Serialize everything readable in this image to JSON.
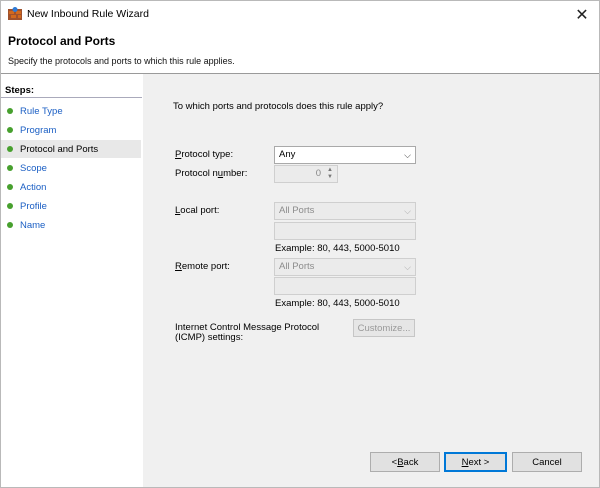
{
  "window": {
    "title": "New Inbound Rule Wizard",
    "close_glyph": "✕"
  },
  "header": {
    "title": "Protocol and Ports",
    "subtitle": "Specify the protocols and ports to which this rule applies."
  },
  "steps": {
    "heading": "Steps:",
    "items": [
      {
        "label": "Rule Type"
      },
      {
        "label": "Program"
      },
      {
        "label": "Protocol and Ports"
      },
      {
        "label": "Scope"
      },
      {
        "label": "Action"
      },
      {
        "label": "Profile"
      },
      {
        "label": "Name"
      }
    ],
    "active_index": 2
  },
  "main": {
    "question": "To which ports and protocols does this rule apply?",
    "protocol_type": {
      "label_prefix": "",
      "label_ul": "P",
      "label_rest": "rotocol type:",
      "value": "Any"
    },
    "protocol_number": {
      "label_pre": "Protocol n",
      "label_ul": "u",
      "label_rest": "mber:",
      "value": "0"
    },
    "local_port": {
      "label_ul": "L",
      "label_rest": "ocal port:",
      "value": "All Ports",
      "example": "Example: 80, 443, 5000-5010"
    },
    "remote_port": {
      "label_ul": "R",
      "label_rest": "emote port:",
      "value": "All Ports",
      "example": "Example: 80, 443, 5000-5010"
    },
    "icmp": {
      "label_line1": "Internet Control Message Protocol",
      "label_line2": "(ICMP) settings:",
      "button": "Customize..."
    }
  },
  "footer": {
    "back_ul": "B",
    "back_pre": "< ",
    "back_rest": "ack",
    "next_ul": "N",
    "next_rest": "ext >",
    "cancel": "Cancel"
  }
}
